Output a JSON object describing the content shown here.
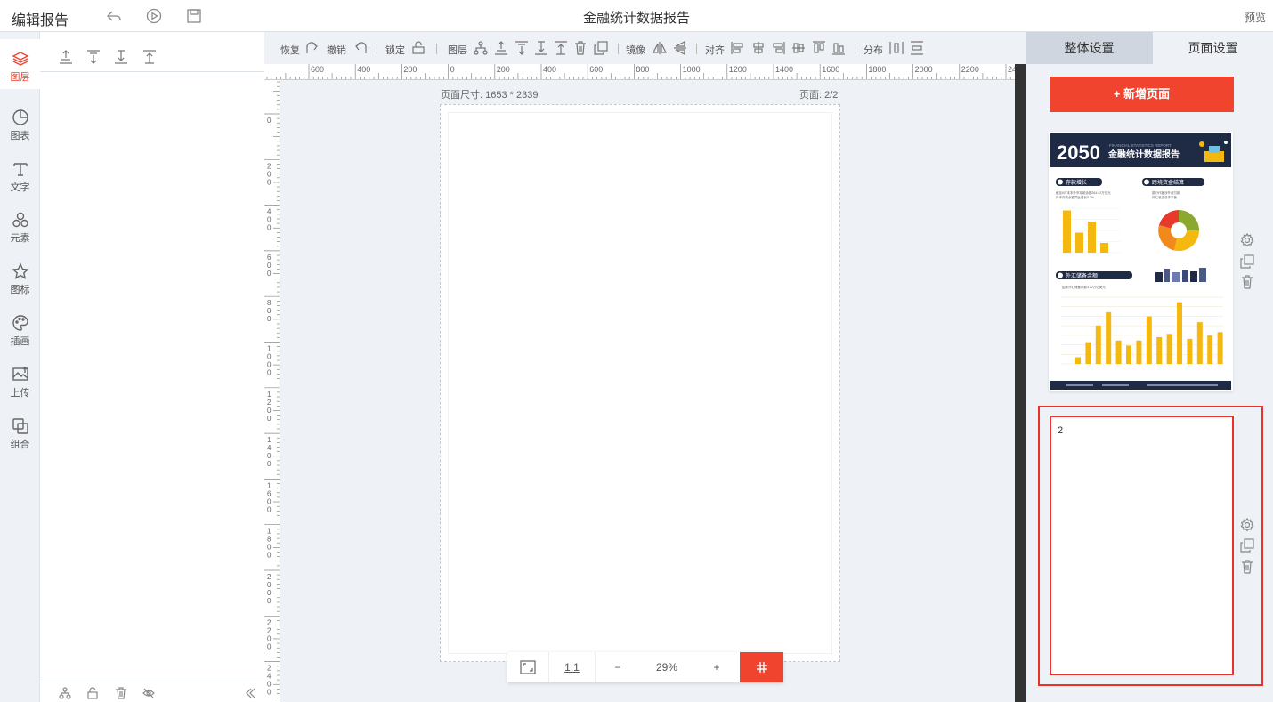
{
  "topbar": {
    "app_title": "编辑报告",
    "doc_title": "金融统计数据报告",
    "preview_label": "预览",
    "icons": [
      "undo-icon",
      "play-icon",
      "save-icon"
    ]
  },
  "leftnav": {
    "items": [
      {
        "label": "图层",
        "icon": "layers-icon",
        "active": true
      },
      {
        "label": "图表",
        "icon": "chart-icon"
      },
      {
        "label": "文字",
        "icon": "text-icon"
      },
      {
        "label": "元素",
        "icon": "elements-icon"
      },
      {
        "label": "图标",
        "icon": "star-icon"
      },
      {
        "label": "插画",
        "icon": "palette-icon"
      },
      {
        "label": "上传",
        "icon": "upload-icon"
      },
      {
        "label": "组合",
        "icon": "group-icon"
      }
    ]
  },
  "toolbar": {
    "redo_label": "恢复",
    "undo_label": "撤销",
    "lock_label": "锁定",
    "layer_label": "图层",
    "mirror_label": "镜像",
    "align_label": "对齐",
    "distribute_label": "分布"
  },
  "rulers": {
    "h_labels": [
      "600",
      "400",
      "200",
      "0",
      "200",
      "400",
      "600",
      "800",
      "1000",
      "1200",
      "1400",
      "1600",
      "1800",
      "2000",
      "2200",
      "2400"
    ],
    "v_labels": [
      "0",
      "200",
      "400",
      "600",
      "800",
      "1000",
      "1200",
      "1400",
      "1600",
      "1800",
      "2000",
      "2200",
      "2400"
    ]
  },
  "canvas": {
    "page_size": "页面尺寸: 1653 * 2339",
    "page_indicator": "页面: 2/2"
  },
  "zoom": {
    "ratio_label": "1:1",
    "minus": "−",
    "value": "29%",
    "plus": "+"
  },
  "rightpanel": {
    "tab_global": "整体设置",
    "tab_page": "页面设置",
    "add_page": "+ 新增页面",
    "thumb1": {
      "year": "2050",
      "subtitle_en": "FINANCIAL STATISTICS REPORT",
      "title": "金融统计数据报告",
      "sec1": "存款增长",
      "sec2": "跨境资金结算",
      "sec3": "外汇储备余额",
      "desc1": "截至6月末本外币存款余额264.92万亿元",
      "desc1b": "外币存款余额同比增长8.2%",
      "desc2": "银行代客涉外收付款",
      "desc2b": "外汇收支总体平衡",
      "desc3": "国家外汇储备余额3.12万亿美元",
      "bars1": [
        95,
        45,
        70,
        22
      ],
      "bars3": [
        8,
        26,
        46,
        62,
        28,
        22,
        28,
        57,
        32,
        36,
        74,
        30,
        50,
        34,
        38
      ]
    },
    "thumb2_number": "2"
  },
  "colors": {
    "accent": "#f0442f",
    "navy": "#1f2b45",
    "gold": "#f5b80f",
    "selection": "#e8332a"
  }
}
